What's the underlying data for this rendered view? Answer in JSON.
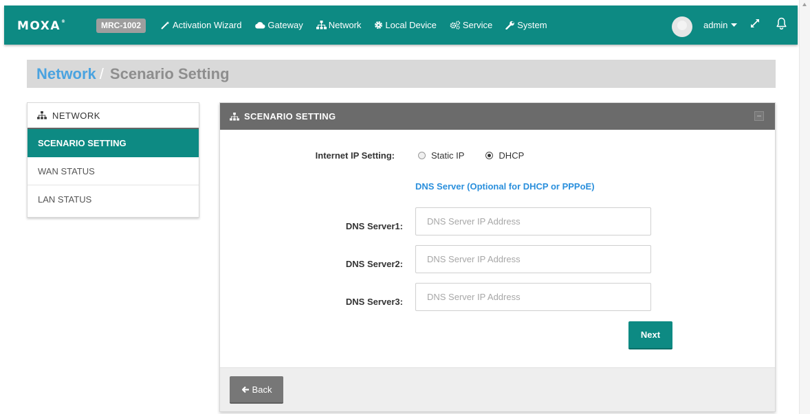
{
  "header": {
    "logo": "MOXA",
    "logo_mark": "®",
    "model": "MRC-1002",
    "nav": [
      {
        "label": "Activation Wizard",
        "icon": "magic-wand-icon"
      },
      {
        "label": "Gateway",
        "icon": "cloud-icon"
      },
      {
        "label": "Network",
        "icon": "sitemap-icon"
      },
      {
        "label": "Local Device",
        "icon": "gear-icon"
      },
      {
        "label": "Service",
        "icon": "gears-icon"
      },
      {
        "label": "System",
        "icon": "wrench-icon"
      }
    ],
    "user": "admin",
    "brand_color": "#0d8a83"
  },
  "breadcrumb": {
    "parent": "Network",
    "separator": "/",
    "current": "Scenario Setting"
  },
  "sidebar": {
    "title": "NETWORK",
    "items": [
      {
        "label": "SCENARIO SETTING",
        "active": true
      },
      {
        "label": "WAN STATUS",
        "active": false
      },
      {
        "label": "LAN STATUS",
        "active": false
      }
    ]
  },
  "panel": {
    "title": "SCENARIO SETTING",
    "ip_setting_label": "Internet IP Setting:",
    "ip_options": [
      {
        "label": "Static IP",
        "checked": false
      },
      {
        "label": "DHCP",
        "checked": true
      }
    ],
    "dns_note": "DNS Server (Optional for DHCP or PPPoE)",
    "dns_fields": [
      {
        "label": "DNS Server1:",
        "placeholder": "DNS Server IP Address",
        "value": ""
      },
      {
        "label": "DNS Server2:",
        "placeholder": "DNS Server IP Address",
        "value": ""
      },
      {
        "label": "DNS Server3:",
        "placeholder": "DNS Server IP Address",
        "value": ""
      }
    ],
    "next_label": "Next",
    "back_label": "Back"
  }
}
